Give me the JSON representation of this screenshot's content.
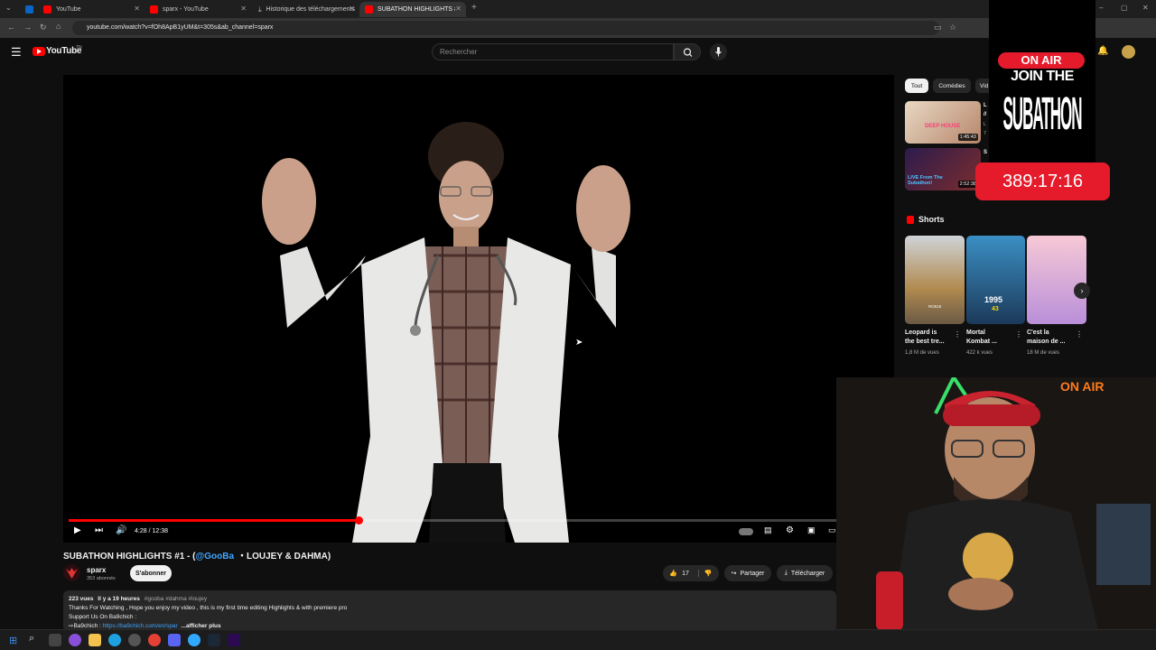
{
  "browser": {
    "tabs": [
      {
        "label": "",
        "color": "#0a66c2"
      },
      {
        "label": "YouTube",
        "color": "#ff0000"
      },
      {
        "label": "sparx - YouTube",
        "color": "#ff0000"
      },
      {
        "label": "Historique des téléchargements",
        "color": "#9aa0a6"
      },
      {
        "label": "SUBATHON HIGHLIGHTS #1 - (",
        "color": "#ff0000"
      }
    ],
    "new_tab": "+",
    "url": "youtube.com/watch?v=fOh8ApB1yUM&t=305s&ab_channel=sparx",
    "window_controls": [
      "–",
      "▢",
      "✕"
    ]
  },
  "youtube": {
    "logo_text": "YouTube",
    "logo_suffix": "TN",
    "search_placeholder": "Rechercher"
  },
  "player": {
    "time": "4:28 / 12:38",
    "progress_fraction": 0.378
  },
  "video": {
    "title_prefix": "SUBATHON HIGHLIGHTS #1 - (",
    "title_mention": "@GooBa",
    "title_suffix": "・LOUJEY & DAHMA)",
    "channel_name": "sparx",
    "subscribers": "353 abonnés",
    "subscribe_label": "S'abonner",
    "likes": "17",
    "share_label": "Partager",
    "download_label": "Télécharger",
    "views": "223 vues",
    "posted": "Il y a 19 heures",
    "hashtags": "#gooba #dahma #loujey",
    "desc_line1": "Thanks For Watching , Hope you enjoy my video , this is my first time editing Highlights & with premiere pro",
    "desc_line2": "Support Us On Ba9chich :",
    "desc_line3_label": "⇨Ba9chich : ",
    "desc_link": "https://ba9chich.com/en/spar",
    "more_label": "...afficher plus"
  },
  "sidebar": {
    "chips": [
      "Tout",
      "Comédies",
      "Vid"
    ],
    "recs": [
      {
        "duration": "1:45:43",
        "overlay": "DEEP HOUSE",
        "t1": "L",
        "t2": "//",
        "t3": "L",
        "t4": "7"
      },
      {
        "duration": "2:52:38",
        "overlay": "LIVE From The Subathon!",
        "t1": "S",
        "t2": "",
        "t3": "",
        "t4": ""
      }
    ],
    "shorts_heading": "Shorts",
    "shorts": [
      {
        "title1": "Leopard is",
        "title2": "the best tre...",
        "meta": "1,8 M de vues",
        "badge": "RO515"
      },
      {
        "title1": "Mortal",
        "title2": "Kombat ...",
        "meta": "422 k vues",
        "badge": "1995"
      },
      {
        "title1": "C'est la",
        "title2": "maison de ...",
        "meta": "18 M de vues",
        "badge": ""
      }
    ],
    "mortal_sub": "43"
  },
  "overlay": {
    "on_air": "ON AIR",
    "join_the": "JOIN THE",
    "subathon": "SUBATHON",
    "timer": "389:17:16",
    "cam_on_air": "ON AIR"
  },
  "colors": {
    "accent": "#ff0000",
    "timer_bg": "#e51b2b",
    "link": "#3ea6ff"
  }
}
